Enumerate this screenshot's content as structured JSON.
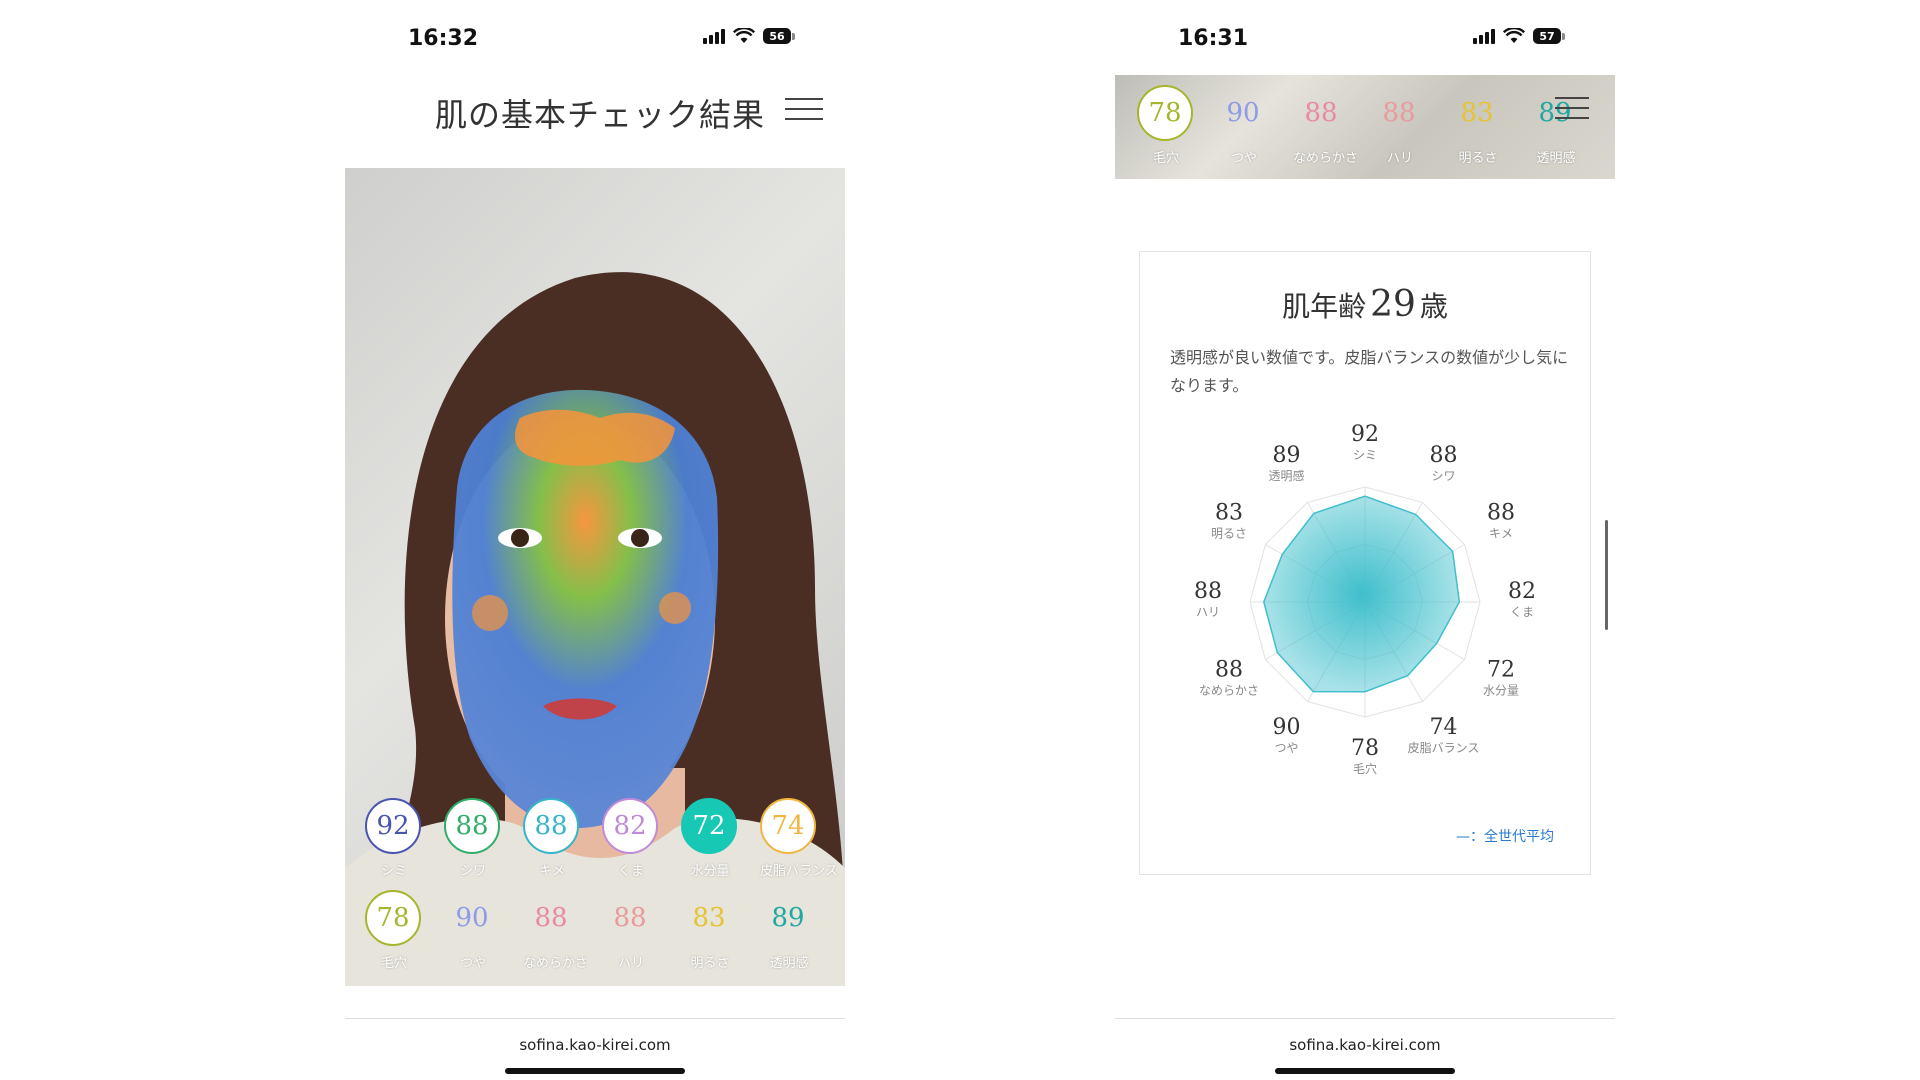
{
  "left_phone": {
    "status": {
      "time": "16:32",
      "battery": "56"
    },
    "title": "肌の基本チェック結果",
    "scores_row1": [
      {
        "label": "シミ",
        "value": "92",
        "color": "#4a55b0",
        "style": "outline"
      },
      {
        "label": "シワ",
        "value": "88",
        "color": "#2fae6a",
        "style": "outline"
      },
      {
        "label": "キメ",
        "value": "88",
        "color": "#36b5c9",
        "style": "outline"
      },
      {
        "label": "くま",
        "value": "82",
        "color": "#c08ad8",
        "style": "outline"
      },
      {
        "label": "水分量",
        "value": "72",
        "color": "#17c8b4",
        "style": "filled"
      },
      {
        "label": "皮脂バランス",
        "value": "74",
        "color": "#f0b640",
        "style": "outline"
      }
    ],
    "scores_row2": [
      {
        "label": "毛穴",
        "value": "78",
        "color": "#a6b52c",
        "style": "outline"
      },
      {
        "label": "つや",
        "value": "90",
        "color": "#8d9be8",
        "style": "plain"
      },
      {
        "label": "なめらかさ",
        "value": "88",
        "color": "#e88aa4",
        "style": "plain"
      },
      {
        "label": "ハリ",
        "value": "88",
        "color": "#e99a9a",
        "style": "plain"
      },
      {
        "label": "明るさ",
        "value": "83",
        "color": "#e6c330",
        "style": "plain"
      },
      {
        "label": "透明感",
        "value": "89",
        "color": "#1fa8a2",
        "style": "plain"
      }
    ],
    "url": "sofina.kao-kirei.com"
  },
  "right_phone": {
    "status": {
      "time": "16:31",
      "battery": "57"
    },
    "strip_scores": [
      {
        "label": "毛穴",
        "value": "78",
        "color": "#a6b52c",
        "style": "outline"
      },
      {
        "label": "つや",
        "value": "90",
        "color": "#8d9be8",
        "style": "plain"
      },
      {
        "label": "なめらかさ",
        "value": "88",
        "color": "#e88aa4",
        "style": "plain"
      },
      {
        "label": "ハリ",
        "value": "88",
        "color": "#e99a9a",
        "style": "plain"
      },
      {
        "label": "明るさ",
        "value": "83",
        "color": "#e6c330",
        "style": "plain"
      },
      {
        "label": "透明感",
        "value": "89",
        "color": "#1fa8a2",
        "style": "plain"
      }
    ],
    "card": {
      "age_prefix": "肌年齢",
      "age_value": "29",
      "age_suffix": "歳",
      "description": "透明感が良い数値です。皮脂バランスの数値が少し気になります。",
      "legend": "—：全世代平均"
    },
    "url": "sofina.kao-kirei.com"
  },
  "chart_data": {
    "type": "radar",
    "categories": [
      "シミ",
      "シワ",
      "キメ",
      "くま",
      "水分量",
      "皮脂バランス",
      "毛穴",
      "つや",
      "なめらかさ",
      "ハリ",
      "明るさ",
      "透明感"
    ],
    "values": [
      92,
      88,
      88,
      82,
      72,
      74,
      78,
      90,
      88,
      88,
      83,
      89
    ],
    "fill_color": "#3fbfcc",
    "average_line_color": "#2a7bd0"
  }
}
